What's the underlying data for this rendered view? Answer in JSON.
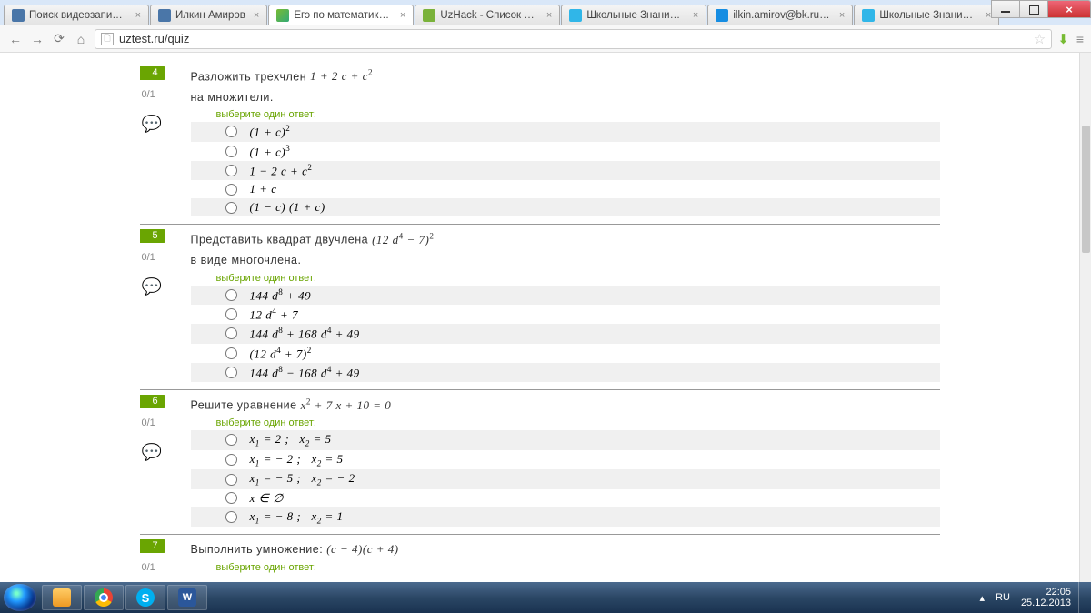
{
  "window": {
    "min": "–",
    "max": "□",
    "close": "×"
  },
  "tabs": [
    {
      "title": "Поиск видеозаписей",
      "fav": "vk"
    },
    {
      "title": "Илкин Амиров",
      "fav": "vk"
    },
    {
      "title": "Егэ по математике, п",
      "fav": "uzt",
      "active": true
    },
    {
      "title": "UzHack - Список зад",
      "fav": "uzh"
    },
    {
      "title": "Школьные Знания.со",
      "fav": "zn"
    },
    {
      "title": "ilkin.amirov@bk.ru - П",
      "fav": "mail"
    },
    {
      "title": "Школьные Знания.со",
      "fav": "zn"
    }
  ],
  "url": "uztest.ru/quiz",
  "common": {
    "instruction": "выберите один ответ:",
    "score": "0/1"
  },
  "questions": [
    {
      "num": "4",
      "text_html": "Разложить трехчлен <span class='math'>1 + 2 c + c<sup>2</sup></span><br>на множители.",
      "options_html": [
        "(1 + c)<sup>2</sup>",
        "(1 + c)<sup>3</sup>",
        "1 − 2 c + c<sup>2</sup>",
        "1 + c",
        "(1 − c) (1 + c)"
      ]
    },
    {
      "num": "5",
      "text_html": "Представить квадрат двучлена <span class='math'>(12 d<sup>4</sup> − 7)<sup>2</sup></span><br>в виде многочлена.",
      "options_html": [
        "144 d<sup>8</sup> + 49",
        "12 d<sup>4</sup> + 7",
        "144 d<sup>8</sup> + 168 d<sup>4</sup> + 49",
        "(12 d<sup>4</sup> + 7)<sup>2</sup>",
        "144 d<sup>8</sup> − 168 d<sup>4</sup> + 49"
      ]
    },
    {
      "num": "6",
      "text_html": "Решите уравнение <span class='math'>x<sup>2</sup> + 7 x + 10 = 0</span>",
      "options_html": [
        "x<sub>1</sub> = 2 ;&nbsp;&nbsp; x<sub>2</sub> = 5",
        "x<sub>1</sub> = − 2 ;&nbsp;&nbsp; x<sub>2</sub> = 5",
        "x<sub>1</sub> = − 5 ;&nbsp;&nbsp; x<sub>2</sub> = − 2",
        "x ∈ ∅",
        "x<sub>1</sub> = − 8 ;&nbsp;&nbsp; x<sub>2</sub> = 1"
      ]
    },
    {
      "num": "7",
      "text_html": "Выполнить умножение: <span class='math'>(c − 4)(c + 4)</span>",
      "options_html": []
    }
  ],
  "tray": {
    "lang": "RU",
    "time": "22:05",
    "date": "25.12.2013"
  }
}
